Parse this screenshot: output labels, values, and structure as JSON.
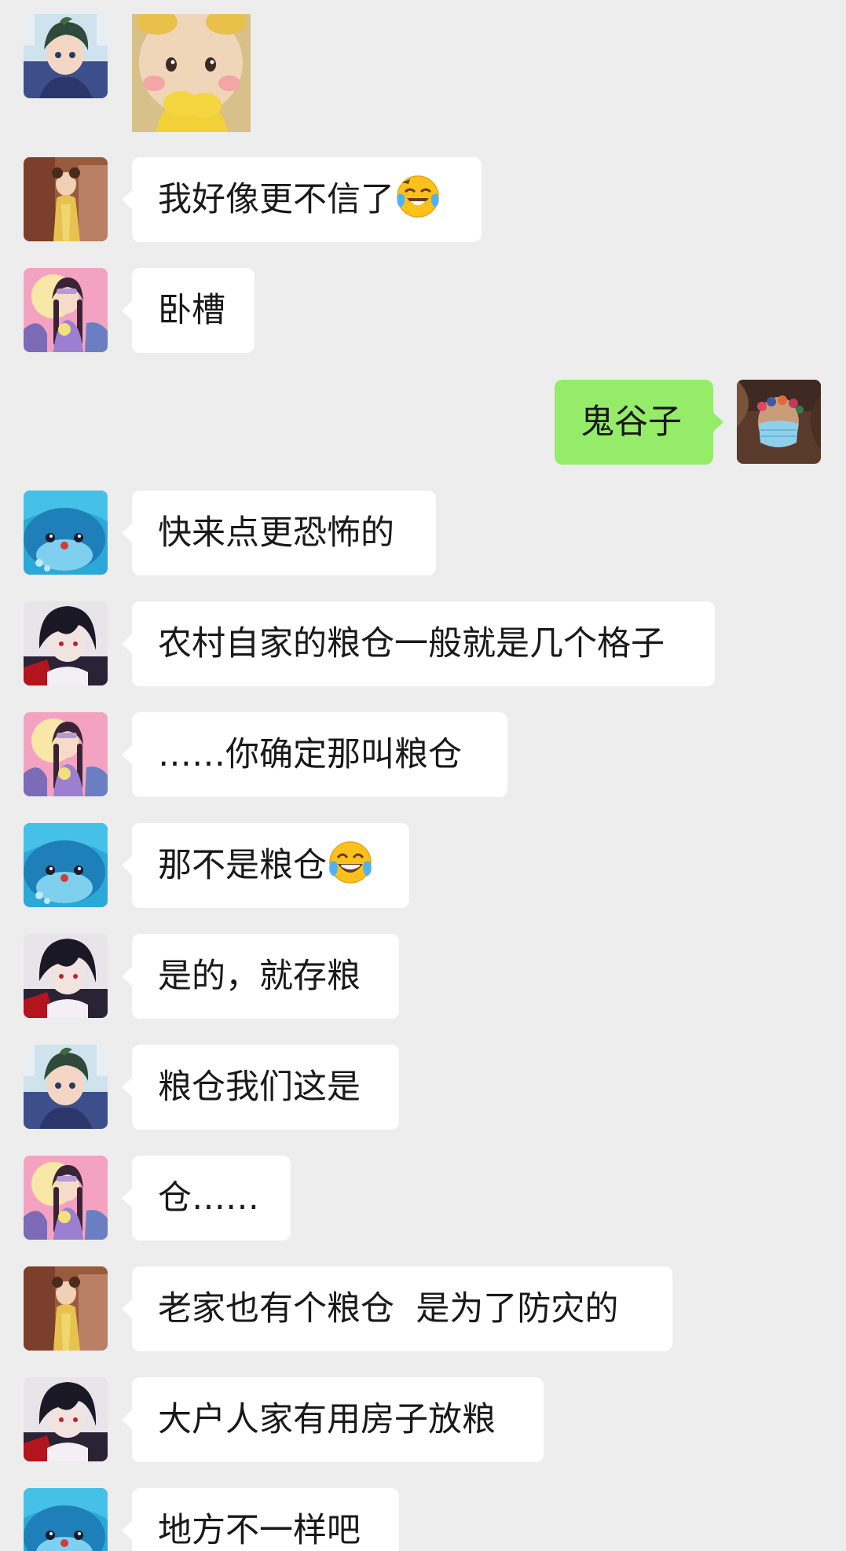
{
  "messages": [
    {
      "sender": "green-hair-boy",
      "type": "sticker",
      "sticker": "yellow-doll-sticker"
    },
    {
      "sender": "orange-girl",
      "type": "text",
      "text": "我好像更不信了",
      "emoji": "crying-laughing-face"
    },
    {
      "sender": "pink-girl",
      "type": "text",
      "text": "卧槽"
    },
    {
      "sender": "self",
      "type": "text",
      "text": "鬼谷子",
      "outgoing": true
    },
    {
      "sender": "blue-whale",
      "type": "text",
      "text": "快来点更恐怖的"
    },
    {
      "sender": "dark-hair-boy",
      "type": "text",
      "text": "农村自家的粮仓一般就是几个格子"
    },
    {
      "sender": "pink-girl",
      "type": "text",
      "text": "……你确定那叫粮仓"
    },
    {
      "sender": "blue-whale",
      "type": "text",
      "text": "那不是粮仓",
      "emoji": "tears-of-joy-face"
    },
    {
      "sender": "dark-hair-boy",
      "type": "text",
      "text": "是的，就存粮"
    },
    {
      "sender": "green-hair-boy",
      "type": "text",
      "text": "粮仓我们这是"
    },
    {
      "sender": "pink-girl",
      "type": "text",
      "text": "仓……"
    },
    {
      "sender": "orange-girl",
      "type": "text",
      "text": "老家也有个粮仓  是为了防灾的"
    },
    {
      "sender": "dark-hair-boy",
      "type": "text",
      "text": "大户人家有用房子放粮"
    },
    {
      "sender": "blue-whale",
      "type": "text",
      "text": "地方不一样吧"
    }
  ],
  "colors": {
    "background": "#ededed",
    "incoming_bubble": "#ffffff",
    "outgoing_bubble": "#95ec69",
    "text": "#191919"
  }
}
